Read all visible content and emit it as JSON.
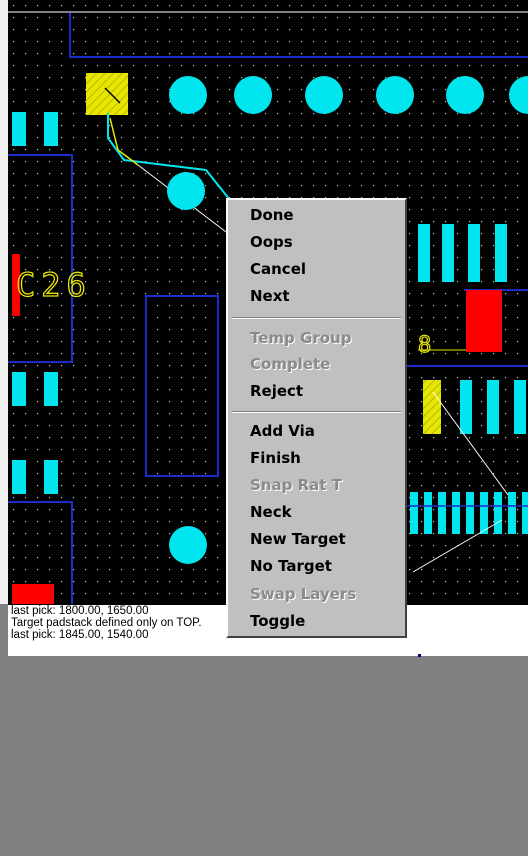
{
  "pcb": {
    "silkscreen_ref": "C26",
    "silkscreen_partial": "8"
  },
  "context_menu": {
    "items": [
      {
        "label": "Done",
        "enabled": true
      },
      {
        "label": "Oops",
        "enabled": true
      },
      {
        "label": "Cancel",
        "enabled": true
      },
      {
        "label": "Next",
        "enabled": true
      },
      {
        "label": "Temp Group",
        "enabled": false
      },
      {
        "label": "Complete",
        "enabled": false
      },
      {
        "label": "Reject",
        "enabled": true
      },
      {
        "label": "Add Via",
        "enabled": true
      },
      {
        "label": "Finish",
        "enabled": true
      },
      {
        "label": "Snap Rat T",
        "enabled": false
      },
      {
        "label": "Neck",
        "enabled": true
      },
      {
        "label": "New Target",
        "enabled": true
      },
      {
        "label": "No Target",
        "enabled": true
      },
      {
        "label": "Swap Layers",
        "enabled": false
      },
      {
        "label": "Toggle",
        "enabled": true
      }
    ]
  },
  "command_log": {
    "lines": [
      "last pick:  1800.00, 1650.00",
      "Target padstack defined only on TOP.",
      "last pick:  1845.00, 1540.00"
    ]
  },
  "colors": {
    "board_background": "#000000",
    "pad": "#00e5ee",
    "component_pad": "#ff0000",
    "selected_pad": "#ffff00",
    "outline": "#1a2ecc",
    "silkscreen": "#e6e600",
    "trace": "#00e5ee",
    "ratsnest": "#ffffff",
    "menu_background": "#c0c0c0"
  }
}
